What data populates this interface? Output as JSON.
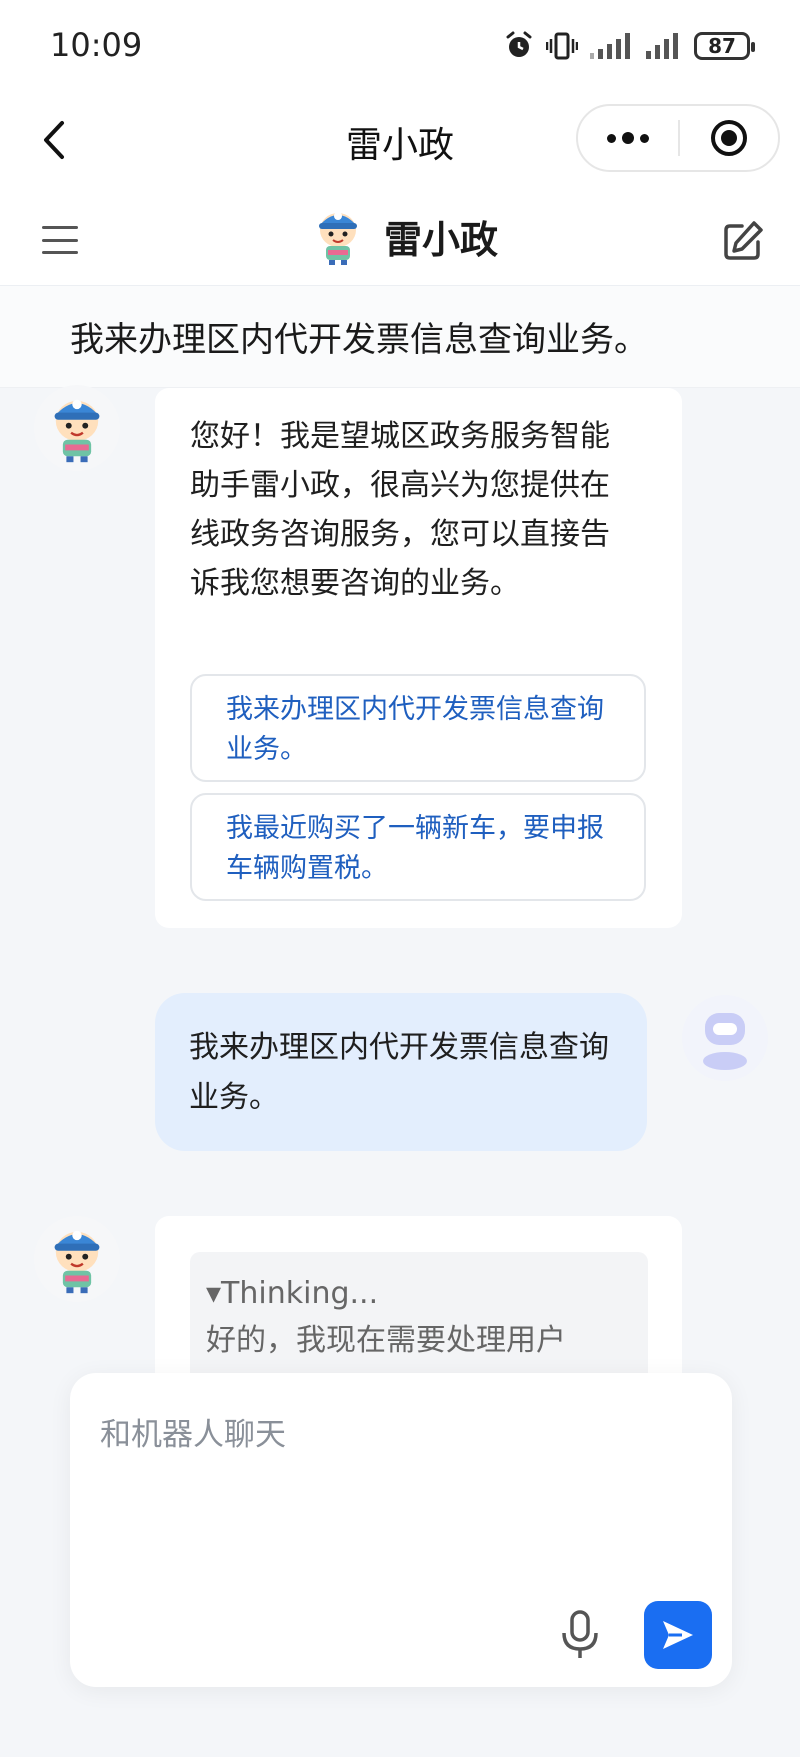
{
  "status_bar": {
    "time": "10:09",
    "battery": "87"
  },
  "title_bar": {
    "title": "雷小政"
  },
  "app_header": {
    "name": "雷小政"
  },
  "context_banner": "我来办理区内代开发票信息查询业务。",
  "messages": {
    "greeting": "您好！我是望城区政务服务智能助手雷小政，很高兴为您提供在线政务咨询服务，您可以直接告诉我您想要咨询的业务。",
    "suggestions": [
      "我来办理区内代开发票信息查询业务。",
      "我最近购买了一辆新车，要申报车辆购置税。"
    ],
    "user_message": "我来办理区内代开发票信息查询业务。",
    "thinking_label": "▾Thinking...",
    "thinking_text": "好的，我现在需要处理用户"
  },
  "composer": {
    "placeholder": "和机器人聊天"
  },
  "colors": {
    "accent": "#1a6ef2",
    "user_bubble": "#e3eefd",
    "link": "#1f5fbf"
  },
  "icons": [
    "back-arrow-icon",
    "more-dots-icon",
    "close-target-icon",
    "menu-icon",
    "edit-icon",
    "mic-icon",
    "send-icon",
    "alarm-icon",
    "vibrate-icon",
    "signal-icon",
    "battery-icon"
  ]
}
